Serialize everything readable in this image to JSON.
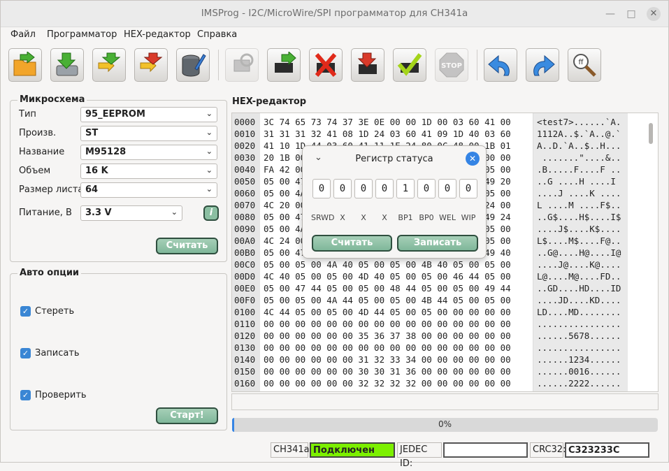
{
  "window": {
    "title": "IMSProg - I2C/MicroWire/SPI программатор для CH341a"
  },
  "menu": [
    "Файл",
    "Программатор",
    "HEX-редактор",
    "Справка"
  ],
  "toolbar_icons": [
    "open-file-icon",
    "save-file-icon",
    "import-icon",
    "export-icon",
    "edit-icon",
    "detect-chip-icon",
    "read-chip-icon",
    "erase-chip-icon",
    "write-chip-icon",
    "verify-chip-icon",
    "stop-icon",
    "undo-icon",
    "redo-icon",
    "search-icon"
  ],
  "chip": {
    "group_title": "Микросхема",
    "type_label": "Тип",
    "type_value": "95_EEPROM",
    "manuf_label": "Произв.",
    "manuf_value": "ST",
    "name_label": "Название",
    "name_value": "M95128",
    "size_label": "Объем",
    "size_value": "16 K",
    "page_label": "Размер листа",
    "page_value": "64",
    "power_label": "Питание, В",
    "power_value": "3.3 V",
    "info_label": "i",
    "read_button": "Считать"
  },
  "auto": {
    "group_title": "Авто опции",
    "erase": "Стереть",
    "write": "Записать",
    "verify": "Проверить",
    "start_button": "Старт!"
  },
  "hex": {
    "title": "HEX-редактор",
    "rows": [
      {
        "addr": "0000",
        "bytes": "3C 74 65 73 74 37 3E 0E 00 00 1D 00 03 60 41 00",
        "ascii": "<test7>......`A."
      },
      {
        "addr": "0010",
        "bytes": "31 31 31 32 41 08 1D 24 03 60 41 09 1D 40 03 60",
        "ascii": "1112A..$.`A..@.`"
      },
      {
        "addr": "0020",
        "bytes": "41 10 1D 44 03 60 41 11 1E 24 80 0C 48 00 1B 01",
        "ascii": "A..D.`A..$..H..."
      },
      {
        "addr": "0030",
        "bytes": "20 1B 00 00 00 00 00 00 00 00 00 00 00 00 00 00",
        "ascii": " .......\"....&.."
      },
      {
        "addr": "0040",
        "bytes": "FA 42 00 00 00 00 00 00 00 00 00 00 00 00 05 00",
        "ascii": ".B.....F....F .."
      },
      {
        "addr": "0050",
        "bytes": "05 00 47 00 00 00 00 00 00 00 00 00 00 00 49 20",
        "ascii": "..G ....H ....I "
      },
      {
        "addr": "0060",
        "bytes": "05 00 4A 00 00 00 00 00 00 00 00 00 00 00 05 00",
        "ascii": "....J ....K ...."
      },
      {
        "addr": "0070",
        "bytes": "4C 20 00 00 00 00 00 00 00 00 00 00 00 00 24 00",
        "ascii": "L ....M ....F$.."
      },
      {
        "addr": "0080",
        "bytes": "05 00 47 00 00 00 00 00 00 00 00 00 00 00 49 24",
        "ascii": "..G$....H$....I$"
      },
      {
        "addr": "0090",
        "bytes": "05 00 4A 00 00 00 00 00 00 00 00 00 00 00 05 00",
        "ascii": "....J$....K$...."
      },
      {
        "addr": "00A0",
        "bytes": "4C 24 00 00 00 00 00 00 00 00 00 00 00 00 05 00",
        "ascii": "L$....M$....F@.."
      },
      {
        "addr": "00B0",
        "bytes": "05 00 47 00 00 00 00 00 00 00 00 00 00 00 49 40",
        "ascii": "..G@....H@....I@"
      },
      {
        "addr": "00C0",
        "bytes": "05 00 05 00 4A 40 05 00 05 00 4B 40 05 00 05 00",
        "ascii": "....J@....K@...."
      },
      {
        "addr": "00D0",
        "bytes": "4C 40 05 00 05 00 4D 40 05 00 05 00 46 44 05 00",
        "ascii": "L@....M@....FD.."
      },
      {
        "addr": "00E0",
        "bytes": "05 00 47 44 05 00 05 00 48 44 05 00 05 00 49 44",
        "ascii": "..GD....HD....ID"
      },
      {
        "addr": "00F0",
        "bytes": "05 00 05 00 4A 44 05 00 05 00 4B 44 05 00 05 00",
        "ascii": "....JD....KD...."
      },
      {
        "addr": "0100",
        "bytes": "4C 44 05 00 05 00 4D 44 05 00 05 00 00 00 00 00",
        "ascii": "LD....MD........"
      },
      {
        "addr": "0110",
        "bytes": "00 00 00 00 00 00 00 00 00 00 00 00 00 00 00 00",
        "ascii": "................"
      },
      {
        "addr": "0120",
        "bytes": "00 00 00 00 00 00 35 36 37 38 00 00 00 00 00 00",
        "ascii": "......5678......"
      },
      {
        "addr": "0130",
        "bytes": "00 00 00 00 00 00 00 00 00 00 00 00 00 00 00 00",
        "ascii": "................"
      },
      {
        "addr": "0140",
        "bytes": "00 00 00 00 00 00 31 32 33 34 00 00 00 00 00 00",
        "ascii": "......1234......"
      },
      {
        "addr": "0150",
        "bytes": "00 00 00 00 00 00 30 30 31 36 00 00 00 00 00 00",
        "ascii": "......0016......"
      },
      {
        "addr": "0160",
        "bytes": "00 00 00 00 00 00 32 32 32 32 00 00 00 00 00 00",
        "ascii": "......2222......"
      }
    ]
  },
  "progress": {
    "label": "0%",
    "fraction": 0.005
  },
  "status": {
    "ch341_label": "CH341a:",
    "ch341_value": "Подключен",
    "jedec_label": "JEDEC ID:",
    "jedec_value": "",
    "crc_label": "CRC32:",
    "crc_value": "C323233C"
  },
  "status_dialog": {
    "title": "Регистр статуса",
    "bits": [
      "0",
      "0",
      "0",
      "0",
      "1",
      "0",
      "0",
      "0"
    ],
    "bit_labels": [
      "SRWD",
      "X",
      "X",
      "X",
      "BP1",
      "BP0",
      "WEL",
      "WIP"
    ],
    "read_button": "Считать",
    "write_button": "Записать"
  },
  "colors": {
    "accent": "#3584e4",
    "button_green": "#8bbfa2",
    "connected": "#7cf000"
  }
}
